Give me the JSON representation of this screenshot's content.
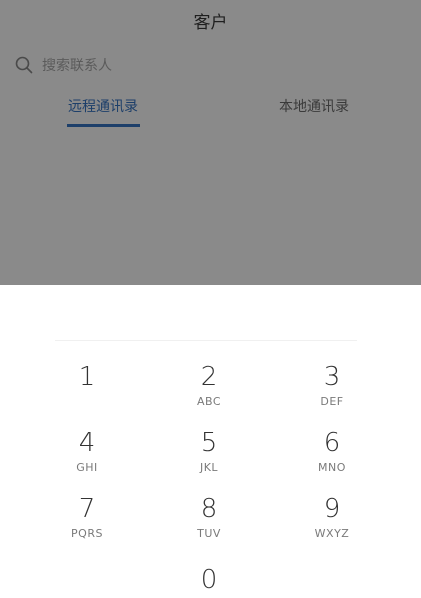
{
  "header": {
    "title": "客户"
  },
  "search": {
    "icon": "search-icon",
    "placeholder": "搜索联系人"
  },
  "tabs": [
    {
      "label": "远程通讯录",
      "selected": true
    },
    {
      "label": "本地通讯录",
      "selected": false
    }
  ],
  "keypad": {
    "keys": [
      {
        "digit": "1",
        "letters": ""
      },
      {
        "digit": "2",
        "letters": "ABC"
      },
      {
        "digit": "3",
        "letters": "DEF"
      },
      {
        "digit": "4",
        "letters": "GHI"
      },
      {
        "digit": "5",
        "letters": "JKL"
      },
      {
        "digit": "6",
        "letters": "MNO"
      },
      {
        "digit": "7",
        "letters": "PQRS"
      },
      {
        "digit": "8",
        "letters": "TUV"
      },
      {
        "digit": "9",
        "letters": "WXYZ"
      },
      {
        "digit": "0",
        "letters": ""
      }
    ]
  },
  "colors": {
    "accent": "#1d3f6a",
    "overlay": "#8a8a8a",
    "sheet": "#ffffff"
  }
}
